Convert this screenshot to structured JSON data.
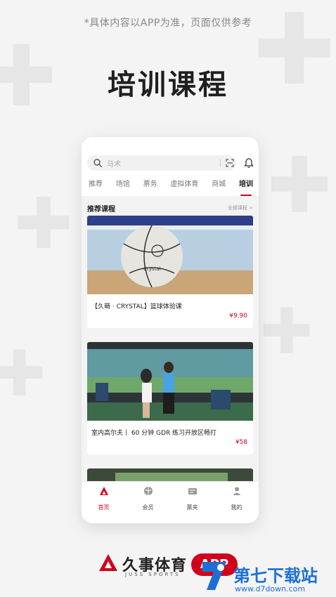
{
  "disclaimer": "*具体内容以APP为准，页面仅供参考",
  "headline": "培训课程",
  "search": {
    "placeholder": "马术"
  },
  "tabs": [
    {
      "label": "推荐",
      "active": false
    },
    {
      "label": "场馆",
      "active": false
    },
    {
      "label": "票务",
      "active": false
    },
    {
      "label": "虚拟体育",
      "active": false
    },
    {
      "label": "商城",
      "active": false
    },
    {
      "label": "培训",
      "active": true
    }
  ],
  "section": {
    "title": "推荐课程",
    "more": "全部课程 >"
  },
  "courses": [
    {
      "title": "【久萌 · CRYSTAL】篮球体验课",
      "price": "¥9.90"
    },
    {
      "title": "室内高尔夫丨 60 分钟 GDR 练习开放区畅打",
      "price": "¥58"
    }
  ],
  "bottom_nav": [
    {
      "label": "首页",
      "icon": "home-icon",
      "active": true
    },
    {
      "label": "会员",
      "icon": "member-icon",
      "active": false
    },
    {
      "label": "票夹",
      "icon": "ticket-icon",
      "active": false
    },
    {
      "label": "我的",
      "icon": "profile-icon",
      "active": false
    }
  ],
  "brand": {
    "name_cn": "久事体育",
    "name_en": "JUSS SPORTS",
    "badge": "APP"
  },
  "watermark": {
    "text": "第七下载站",
    "url": "www.d7down.com"
  },
  "colors": {
    "accent": "#d0021b",
    "watermark": "#1d6fd6"
  }
}
